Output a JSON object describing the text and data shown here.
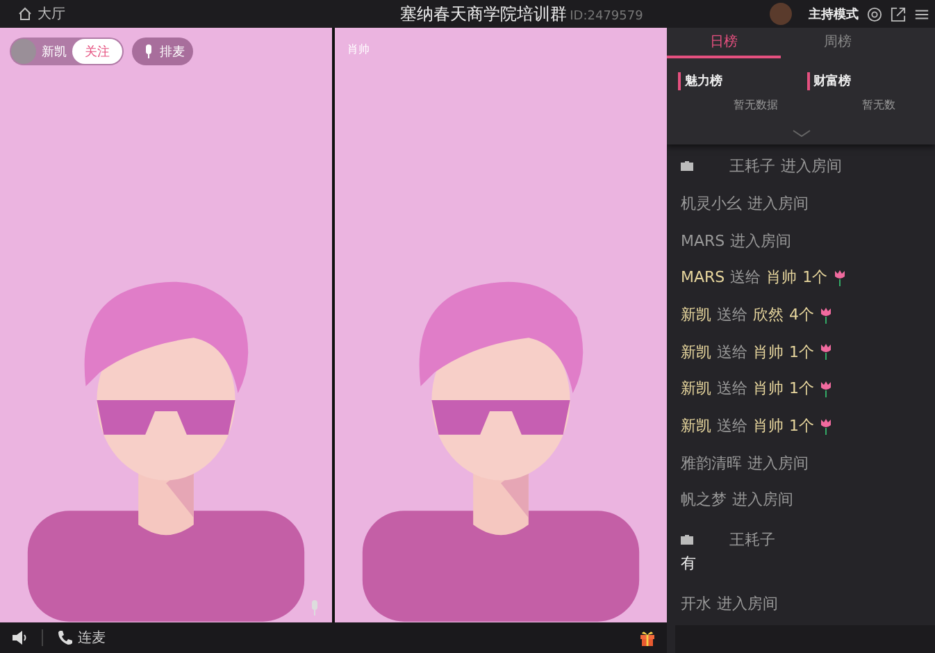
{
  "header": {
    "back_label": "大厅",
    "title": "塞纳春天商学院培训群",
    "room_id": "ID:2479579",
    "mode_label": "主持模式"
  },
  "videos": [
    {
      "kind": "host",
      "name": "新凯",
      "follow_label": "关注",
      "queue_label": "排麦"
    },
    {
      "kind": "guest",
      "name": "肖帅"
    }
  ],
  "rank_panel": {
    "tabs": [
      {
        "label": "日榜",
        "selected": true
      },
      {
        "label": "周榜",
        "selected": false
      }
    ],
    "boards": [
      {
        "title": "魅力榜",
        "empty_text": "暂无数据"
      },
      {
        "title": "财富榜",
        "empty_text": "暂无数"
      }
    ]
  },
  "chat": [
    {
      "kind": "enter",
      "badge": true,
      "user": "王耗子",
      "action": "进入房间"
    },
    {
      "kind": "enter",
      "badge": false,
      "user": "机灵小幺",
      "action": "进入房间"
    },
    {
      "kind": "enter",
      "badge": false,
      "user": "MARS",
      "action": "进入房间"
    },
    {
      "kind": "gift",
      "user": "MARS",
      "action": "送给",
      "recipient": "肖帅",
      "count": "1个"
    },
    {
      "kind": "gift",
      "user": "新凯",
      "action": "送给",
      "recipient": "欣然",
      "count": "4个"
    },
    {
      "kind": "gift",
      "user": "新凯",
      "action": "送给",
      "recipient": "肖帅",
      "count": "1个"
    },
    {
      "kind": "gift",
      "user": "新凯",
      "action": "送给",
      "recipient": "肖帅",
      "count": "1个"
    },
    {
      "kind": "gift",
      "user": "新凯",
      "action": "送给",
      "recipient": "肖帅",
      "count": "1个"
    },
    {
      "kind": "enter",
      "badge": false,
      "user": "雅韵清晖",
      "action": "进入房间"
    },
    {
      "kind": "enter",
      "badge": false,
      "user": "帆之梦",
      "action": "进入房间"
    },
    {
      "kind": "speech",
      "badge": true,
      "user": "王耗子",
      "text": "有"
    },
    {
      "kind": "enter",
      "badge": false,
      "user": "开水",
      "action": "进入房间"
    }
  ],
  "bottom_bar": {
    "mic_link_label": "连麦"
  }
}
